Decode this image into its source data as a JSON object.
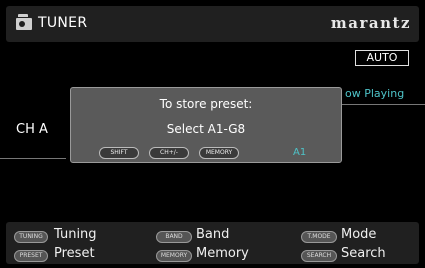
{
  "header": {
    "title": "TUNER",
    "brand": "marantz",
    "icon": "tuner-icon"
  },
  "status": {
    "auto_badge": "AUTO",
    "now_playing": "ow Playing",
    "channel": "CH A"
  },
  "dialog": {
    "line1": "To store preset:",
    "line2": "Select A1-G8",
    "chips": [
      "SHIFT",
      "CH+/-",
      "MEMORY"
    ],
    "current_preset": "A1"
  },
  "footer": {
    "items": [
      {
        "chip": "TUNING",
        "label": "Tuning"
      },
      {
        "chip": "BAND",
        "label": "Band"
      },
      {
        "chip": "T.MODE",
        "label": "Mode"
      },
      {
        "chip": "PRESET",
        "label": "Preset"
      },
      {
        "chip": "MEMORY",
        "label": "Memory"
      },
      {
        "chip": "SEARCH",
        "label": "Search"
      }
    ]
  },
  "colors": {
    "accent": "#4ec3c8",
    "panel": "#202020",
    "dialog": "#5a5a5a"
  }
}
